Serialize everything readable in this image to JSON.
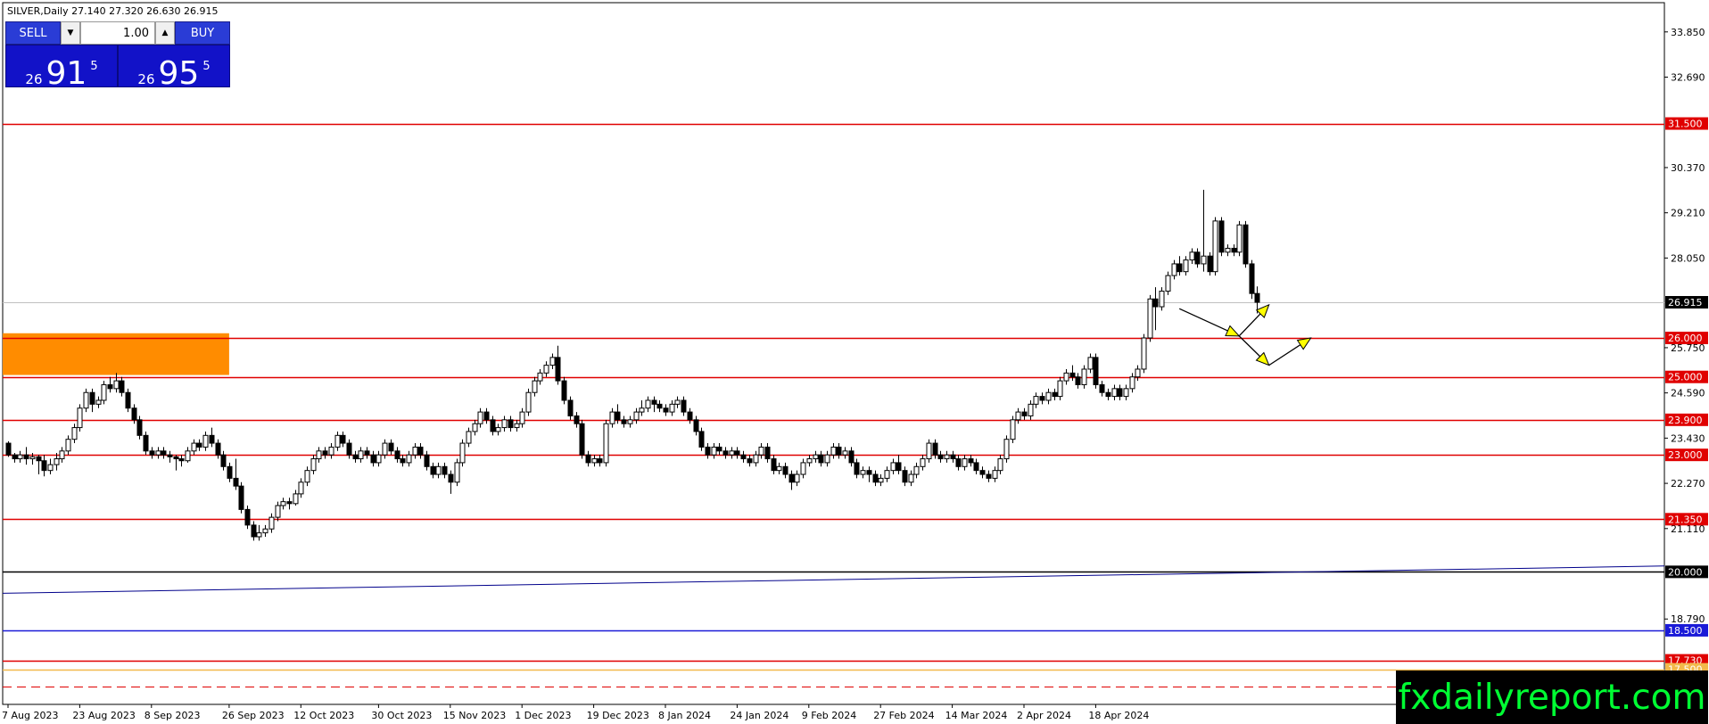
{
  "header": {
    "symbol": "SILVER,Daily",
    "ohlc": "27.140 27.320 26.630 26.915"
  },
  "trade_panel": {
    "sell_label": "SELL",
    "buy_label": "BUY",
    "lot": "1.00",
    "bid": {
      "prefix": "26",
      "main": "91",
      "sup": "5"
    },
    "ask": {
      "prefix": "26",
      "main": "95",
      "sup": "5"
    }
  },
  "brand": "fxdailyreport.com",
  "colors": {
    "level": "#e00000",
    "zone": "#ff8c00",
    "trend": "#00008b",
    "level_blue": "#1a1ad8",
    "brand_text": "#00ff33",
    "arrow": "#ffff00"
  },
  "chart_data": {
    "type": "candlestick",
    "title": "SILVER,Daily",
    "ylim": [
      16.6,
      34.6
    ],
    "y_ticks": [
      "33.850",
      "32.690",
      "30.370",
      "29.210",
      "28.050",
      "25.750",
      "24.590",
      "23.430",
      "22.270",
      "21.110",
      "18.790"
    ],
    "x_ticks": [
      "7 Aug 2023",
      "23 Aug 2023",
      "8 Sep 2023",
      "26 Sep 2023",
      "12 Oct 2023",
      "30 Oct 2023",
      "15 Nov 2023",
      "1 Dec 2023",
      "19 Dec 2023",
      "8 Jan 2024",
      "24 Jan 2024",
      "9 Feb 2024",
      "27 Feb 2024",
      "14 Mar 2024",
      "2 Apr 2024",
      "18 Apr 2024"
    ],
    "levels": [
      {
        "value": 31.5,
        "label": "31.500",
        "color": "#e00000"
      },
      {
        "value": 26.0,
        "label": "26.000",
        "color": "#e00000"
      },
      {
        "value": 25.0,
        "label": "25.000",
        "color": "#e00000"
      },
      {
        "value": 23.9,
        "label": "23.900",
        "color": "#e00000"
      },
      {
        "value": 23.0,
        "label": "23.000",
        "color": "#e00000"
      },
      {
        "value": 21.35,
        "label": "21.350",
        "color": "#e00000"
      },
      {
        "value": 20.0,
        "label": "20.000",
        "color": "#000000"
      },
      {
        "value": 18.5,
        "label": "18.500",
        "color": "#1a1ad8"
      },
      {
        "value": 17.73,
        "label": "17.730",
        "color": "#e00000"
      },
      {
        "value": 17.5,
        "label": "17.500",
        "color": "#f2b84a"
      }
    ],
    "current_price": {
      "value": 26.915,
      "label": "26.915"
    },
    "zone": {
      "x_start": 0,
      "x_end": 37,
      "low": 25.05,
      "high": 26.12
    },
    "trendline": {
      "start": [
        0,
        19.45
      ],
      "end": [
        264,
        20.15
      ]
    },
    "dashed_line": 17.05,
    "projection_arrows": [
      {
        "from": [
          196,
          26.75
        ],
        "to": [
          206,
          26.05
        ]
      },
      {
        "from": [
          206,
          26.05
        ],
        "to": [
          211,
          26.85
        ]
      },
      {
        "from": [
          206,
          26.05
        ],
        "to": [
          211,
          25.3
        ]
      },
      {
        "from": [
          211,
          25.3
        ],
        "to": [
          218,
          26.0
        ]
      }
    ],
    "candles": [
      [
        23.3,
        23.0,
        23.35,
        22.95
      ],
      [
        23.0,
        22.9,
        23.05,
        22.8
      ],
      [
        22.9,
        23.0,
        23.1,
        22.8
      ],
      [
        23.0,
        22.9,
        23.2,
        22.75
      ],
      [
        22.9,
        22.95,
        23.05,
        22.75
      ],
      [
        22.95,
        22.85,
        23.0,
        22.5
      ],
      [
        22.85,
        22.6,
        23.0,
        22.45
      ],
      [
        22.6,
        22.75,
        22.9,
        22.5
      ],
      [
        22.75,
        22.9,
        23.05,
        22.6
      ],
      [
        22.9,
        23.1,
        23.2,
        22.8
      ],
      [
        23.1,
        23.4,
        23.5,
        23.0
      ],
      [
        23.4,
        23.7,
        23.8,
        23.3
      ],
      [
        23.7,
        24.2,
        24.3,
        23.6
      ],
      [
        24.2,
        24.6,
        24.7,
        24.1
      ],
      [
        24.6,
        24.3,
        24.7,
        24.1
      ],
      [
        24.3,
        24.4,
        24.5,
        24.2
      ],
      [
        24.4,
        24.8,
        24.9,
        24.3
      ],
      [
        24.8,
        24.7,
        25.0,
        24.6
      ],
      [
        24.7,
        24.9,
        25.1,
        24.6
      ],
      [
        24.9,
        24.6,
        25.0,
        24.5
      ],
      [
        24.6,
        24.2,
        24.7,
        24.1
      ],
      [
        24.2,
        23.9,
        24.3,
        23.8
      ],
      [
        23.9,
        23.5,
        24.0,
        23.4
      ],
      [
        23.5,
        23.1,
        23.6,
        23.0
      ],
      [
        23.1,
        23.0,
        23.2,
        22.9
      ],
      [
        23.0,
        23.1,
        23.2,
        22.9
      ],
      [
        23.1,
        23.0,
        23.2,
        22.9
      ],
      [
        23.0,
        22.95,
        23.1,
        22.8
      ],
      [
        22.95,
        22.9,
        23.0,
        22.6
      ],
      [
        22.9,
        22.85,
        23.0,
        22.7
      ],
      [
        22.85,
        23.1,
        23.2,
        22.8
      ],
      [
        23.1,
        23.3,
        23.4,
        23.0
      ],
      [
        23.3,
        23.2,
        23.4,
        23.1
      ],
      [
        23.2,
        23.5,
        23.6,
        23.1
      ],
      [
        23.5,
        23.3,
        23.7,
        23.2
      ],
      [
        23.3,
        23.0,
        23.4,
        22.9
      ],
      [
        23.0,
        22.7,
        23.1,
        22.6
      ],
      [
        22.7,
        22.4,
        22.8,
        22.3
      ],
      [
        22.4,
        22.2,
        22.9,
        22.1
      ],
      [
        22.2,
        21.6,
        22.3,
        21.5
      ],
      [
        21.6,
        21.2,
        21.7,
        21.1
      ],
      [
        21.2,
        20.9,
        21.3,
        20.8
      ],
      [
        20.9,
        21.0,
        21.2,
        20.8
      ],
      [
        21.0,
        21.1,
        21.2,
        20.9
      ],
      [
        21.1,
        21.4,
        21.5,
        21.0
      ],
      [
        21.4,
        21.7,
        21.8,
        21.3
      ],
      [
        21.7,
        21.8,
        21.9,
        21.6
      ],
      [
        21.8,
        21.75,
        21.9,
        21.6
      ],
      [
        21.75,
        22.0,
        22.1,
        21.7
      ],
      [
        22.0,
        22.3,
        22.4,
        21.9
      ],
      [
        22.3,
        22.6,
        22.7,
        22.2
      ],
      [
        22.6,
        22.9,
        23.0,
        22.5
      ],
      [
        22.9,
        23.1,
        23.2,
        22.8
      ],
      [
        23.1,
        23.0,
        23.2,
        22.9
      ],
      [
        23.0,
        23.2,
        23.3,
        22.9
      ],
      [
        23.2,
        23.5,
        23.6,
        23.1
      ],
      [
        23.5,
        23.3,
        23.6,
        23.2
      ],
      [
        23.3,
        23.0,
        23.4,
        22.9
      ],
      [
        23.0,
        22.9,
        23.1,
        22.8
      ],
      [
        22.9,
        23.1,
        23.2,
        22.8
      ],
      [
        23.1,
        23.0,
        23.2,
        22.9
      ],
      [
        23.0,
        22.8,
        23.1,
        22.7
      ],
      [
        22.8,
        23.0,
        23.1,
        22.7
      ],
      [
        23.0,
        23.3,
        23.4,
        22.9
      ],
      [
        23.3,
        23.1,
        23.4,
        23.0
      ],
      [
        23.1,
        22.9,
        23.2,
        22.8
      ],
      [
        22.9,
        22.8,
        23.0,
        22.7
      ],
      [
        22.8,
        23.0,
        23.1,
        22.7
      ],
      [
        23.0,
        23.2,
        23.3,
        22.9
      ],
      [
        23.2,
        23.0,
        23.3,
        22.9
      ],
      [
        23.0,
        22.7,
        23.1,
        22.6
      ],
      [
        22.7,
        22.5,
        22.8,
        22.4
      ],
      [
        22.5,
        22.7,
        22.8,
        22.4
      ],
      [
        22.7,
        22.5,
        22.8,
        22.4
      ],
      [
        22.5,
        22.3,
        22.6,
        22.0
      ],
      [
        22.3,
        22.8,
        22.9,
        22.2
      ],
      [
        22.8,
        23.3,
        23.4,
        22.7
      ],
      [
        23.3,
        23.6,
        23.7,
        23.2
      ],
      [
        23.6,
        23.8,
        23.9,
        23.5
      ],
      [
        23.8,
        24.1,
        24.2,
        23.7
      ],
      [
        24.1,
        23.9,
        24.2,
        23.8
      ],
      [
        23.9,
        23.6,
        24.0,
        23.5
      ],
      [
        23.6,
        23.7,
        23.8,
        23.5
      ],
      [
        23.7,
        23.9,
        24.0,
        23.6
      ],
      [
        23.9,
        23.7,
        24.0,
        23.6
      ],
      [
        23.7,
        23.8,
        23.9,
        23.6
      ],
      [
        23.8,
        24.1,
        24.2,
        23.7
      ],
      [
        24.1,
        24.6,
        24.7,
        24.0
      ],
      [
        24.6,
        24.9,
        25.0,
        24.5
      ],
      [
        24.9,
        25.1,
        25.2,
        24.8
      ],
      [
        25.1,
        25.3,
        25.4,
        25.0
      ],
      [
        25.3,
        25.5,
        25.6,
        25.2
      ],
      [
        25.5,
        24.9,
        25.8,
        24.8
      ],
      [
        24.9,
        24.4,
        25.0,
        24.3
      ],
      [
        24.4,
        24.0,
        24.5,
        23.9
      ],
      [
        24.0,
        23.8,
        24.1,
        23.7
      ],
      [
        23.8,
        23.0,
        23.9,
        22.9
      ],
      [
        23.0,
        22.8,
        23.1,
        22.7
      ],
      [
        22.8,
        22.9,
        23.0,
        22.7
      ],
      [
        22.9,
        22.8,
        23.0,
        22.7
      ],
      [
        22.8,
        23.8,
        23.9,
        22.7
      ],
      [
        23.8,
        24.1,
        24.2,
        23.7
      ],
      [
        24.1,
        23.9,
        24.3,
        23.8
      ],
      [
        23.9,
        23.8,
        24.0,
        23.7
      ],
      [
        23.8,
        23.9,
        24.0,
        23.7
      ],
      [
        23.9,
        24.1,
        24.2,
        23.8
      ],
      [
        24.1,
        24.2,
        24.4,
        24.0
      ],
      [
        24.2,
        24.4,
        24.5,
        24.1
      ],
      [
        24.4,
        24.3,
        24.5,
        24.1
      ],
      [
        24.3,
        24.2,
        24.4,
        24.1
      ],
      [
        24.2,
        24.1,
        24.3,
        24.0
      ],
      [
        24.1,
        24.3,
        24.4,
        24.0
      ],
      [
        24.3,
        24.4,
        24.5,
        24.2
      ],
      [
        24.4,
        24.1,
        24.5,
        24.0
      ],
      [
        24.1,
        23.9,
        24.2,
        23.8
      ],
      [
        23.9,
        23.6,
        24.0,
        23.5
      ],
      [
        23.6,
        23.2,
        23.7,
        23.1
      ],
      [
        23.2,
        23.0,
        23.3,
        22.9
      ],
      [
        23.0,
        23.2,
        23.3,
        22.9
      ],
      [
        23.2,
        23.1,
        23.3,
        23.0
      ],
      [
        23.1,
        23.0,
        23.2,
        22.9
      ],
      [
        23.0,
        23.1,
        23.2,
        22.9
      ],
      [
        23.1,
        23.0,
        23.2,
        22.9
      ],
      [
        23.0,
        22.9,
        23.1,
        22.8
      ],
      [
        22.9,
        22.8,
        23.0,
        22.7
      ],
      [
        22.8,
        23.0,
        23.1,
        22.7
      ],
      [
        23.0,
        23.2,
        23.3,
        22.9
      ],
      [
        23.2,
        22.9,
        23.3,
        22.8
      ],
      [
        22.9,
        22.6,
        23.0,
        22.5
      ],
      [
        22.6,
        22.7,
        22.8,
        22.5
      ],
      [
        22.7,
        22.5,
        22.8,
        22.4
      ],
      [
        22.5,
        22.3,
        22.6,
        22.1
      ],
      [
        22.3,
        22.5,
        22.6,
        22.2
      ],
      [
        22.5,
        22.8,
        22.9,
        22.4
      ],
      [
        22.8,
        22.9,
        23.0,
        22.7
      ],
      [
        22.9,
        23.0,
        23.1,
        22.8
      ],
      [
        23.0,
        22.8,
        23.1,
        22.7
      ],
      [
        22.8,
        23.0,
        23.1,
        22.7
      ],
      [
        23.0,
        23.2,
        23.3,
        22.9
      ],
      [
        23.2,
        23.0,
        23.3,
        22.9
      ],
      [
        23.0,
        23.1,
        23.2,
        22.9
      ],
      [
        23.1,
        22.8,
        23.2,
        22.7
      ],
      [
        22.8,
        22.5,
        22.9,
        22.4
      ],
      [
        22.5,
        22.6,
        22.7,
        22.4
      ],
      [
        22.6,
        22.5,
        22.7,
        22.3
      ],
      [
        22.5,
        22.3,
        22.6,
        22.2
      ],
      [
        22.3,
        22.4,
        22.5,
        22.2
      ],
      [
        22.4,
        22.6,
        22.7,
        22.3
      ],
      [
        22.6,
        22.8,
        22.9,
        22.5
      ],
      [
        22.8,
        22.6,
        23.0,
        22.5
      ],
      [
        22.6,
        22.3,
        22.7,
        22.2
      ],
      [
        22.3,
        22.5,
        22.6,
        22.2
      ],
      [
        22.5,
        22.7,
        22.8,
        22.4
      ],
      [
        22.7,
        22.9,
        23.0,
        22.6
      ],
      [
        22.9,
        23.3,
        23.4,
        22.8
      ],
      [
        23.3,
        23.0,
        23.4,
        22.9
      ],
      [
        23.0,
        22.9,
        23.1,
        22.8
      ],
      [
        22.9,
        23.0,
        23.1,
        22.8
      ],
      [
        23.0,
        22.9,
        23.1,
        22.8
      ],
      [
        22.9,
        22.7,
        23.0,
        22.6
      ],
      [
        22.7,
        22.9,
        23.0,
        22.6
      ],
      [
        22.9,
        22.8,
        23.0,
        22.7
      ],
      [
        22.8,
        22.6,
        22.9,
        22.5
      ],
      [
        22.6,
        22.5,
        22.7,
        22.4
      ],
      [
        22.5,
        22.4,
        22.6,
        22.3
      ],
      [
        22.4,
        22.6,
        22.7,
        22.3
      ],
      [
        22.6,
        22.9,
        23.0,
        22.5
      ],
      [
        22.9,
        23.4,
        23.5,
        22.8
      ],
      [
        23.4,
        23.9,
        24.0,
        23.3
      ],
      [
        23.9,
        24.1,
        24.2,
        23.8
      ],
      [
        24.1,
        24.0,
        24.2,
        23.9
      ],
      [
        24.0,
        24.3,
        24.4,
        23.9
      ],
      [
        24.3,
        24.5,
        24.6,
        24.2
      ],
      [
        24.5,
        24.4,
        24.6,
        24.3
      ],
      [
        24.4,
        24.6,
        24.7,
        24.3
      ],
      [
        24.6,
        24.5,
        24.7,
        24.4
      ],
      [
        24.5,
        24.9,
        25.0,
        24.4
      ],
      [
        24.9,
        25.1,
        25.2,
        24.8
      ],
      [
        25.1,
        25.0,
        25.3,
        24.9
      ],
      [
        25.0,
        24.8,
        25.1,
        24.7
      ],
      [
        24.8,
        25.2,
        25.3,
        24.7
      ],
      [
        25.2,
        25.5,
        25.6,
        25.1
      ],
      [
        25.5,
        24.8,
        25.6,
        24.7
      ],
      [
        24.8,
        24.6,
        24.9,
        24.5
      ],
      [
        24.6,
        24.5,
        24.7,
        24.4
      ],
      [
        24.5,
        24.7,
        24.8,
        24.4
      ],
      [
        24.7,
        24.5,
        24.8,
        24.4
      ],
      [
        24.5,
        24.7,
        24.8,
        24.4
      ],
      [
        24.7,
        25.0,
        25.1,
        24.6
      ],
      [
        25.0,
        25.2,
        25.3,
        24.9
      ],
      [
        25.2,
        26.0,
        26.1,
        25.1
      ],
      [
        26.0,
        27.0,
        27.1,
        25.9
      ],
      [
        27.0,
        26.8,
        27.3,
        26.2
      ],
      [
        26.8,
        27.2,
        27.3,
        26.7
      ],
      [
        27.2,
        27.6,
        27.7,
        27.1
      ],
      [
        27.6,
        27.9,
        28.0,
        27.5
      ],
      [
        27.9,
        27.7,
        28.1,
        27.6
      ],
      [
        27.7,
        28.0,
        28.1,
        27.6
      ],
      [
        28.0,
        28.2,
        28.3,
        27.9
      ],
      [
        28.2,
        27.9,
        28.3,
        27.8
      ],
      [
        27.9,
        28.1,
        29.8,
        27.7
      ],
      [
        28.1,
        27.7,
        28.2,
        27.6
      ],
      [
        27.7,
        29.0,
        29.1,
        27.6
      ],
      [
        29.0,
        28.2,
        29.1,
        28.1
      ],
      [
        28.2,
        28.3,
        28.4,
        28.1
      ],
      [
        28.3,
        28.2,
        28.4,
        28.1
      ],
      [
        28.2,
        28.9,
        29.0,
        28.1
      ],
      [
        28.9,
        27.9,
        29.0,
        27.8
      ],
      [
        27.9,
        27.14,
        28.0,
        27.0
      ],
      [
        27.14,
        26.915,
        27.32,
        26.63
      ]
    ]
  }
}
